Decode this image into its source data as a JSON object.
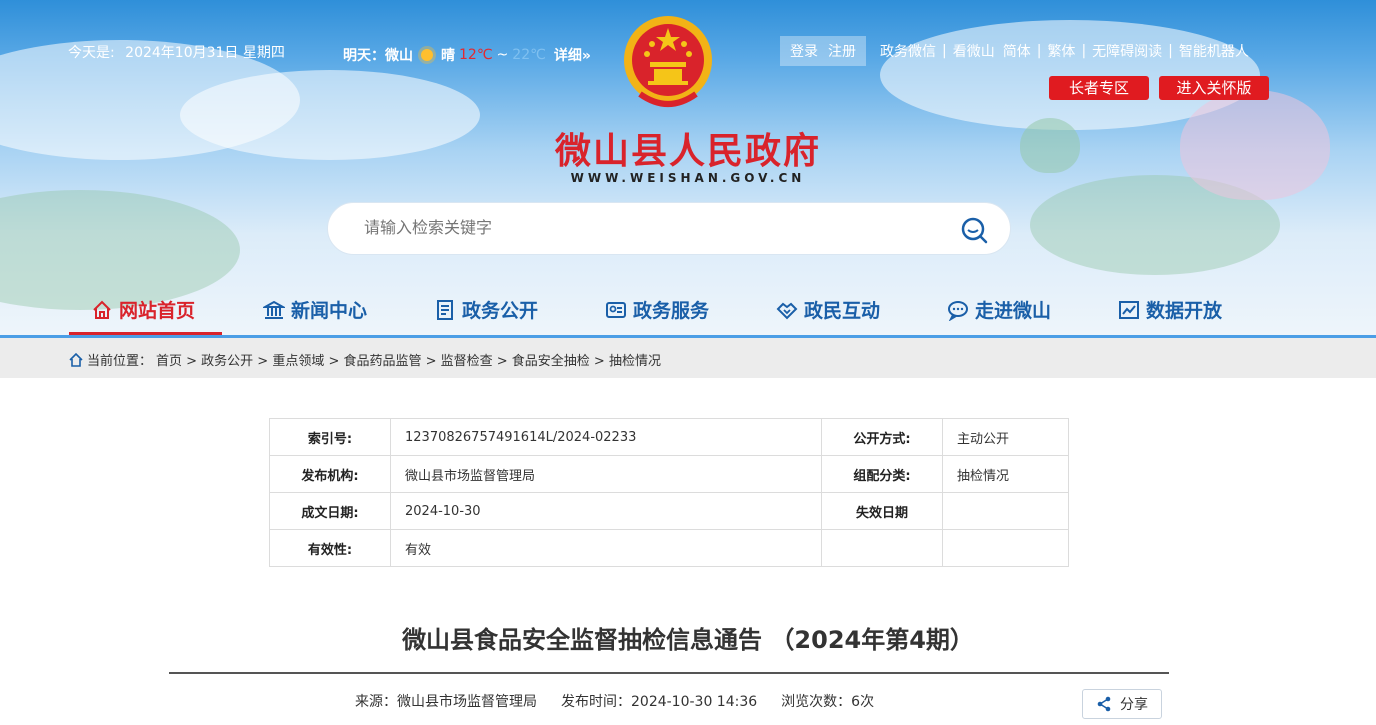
{
  "header": {
    "today_label": "今天是:",
    "today_date": "2024年10月31日 星期四",
    "weather": {
      "label": "明天：微山",
      "condition": "晴",
      "high": "12℃",
      "range_sep": "~",
      "low": "22℃",
      "detail": "详细»"
    },
    "login": "登录",
    "register": "注册",
    "links": [
      "政务微信",
      "看微山",
      "简体",
      "繁体",
      "无障碍阅读",
      "智能机器人"
    ],
    "elder_zone": "长者专区",
    "care_mode": "进入关怀版",
    "site_title": "微山县人民政府",
    "site_domain": "WWW.WEISHAN.GOV.CN"
  },
  "search": {
    "placeholder": "请输入检索关键字"
  },
  "nav": {
    "items": [
      "网站首页",
      "新闻中心",
      "政务公开",
      "政务服务",
      "政民互动",
      "走进微山",
      "数据开放"
    ],
    "active_index": 0
  },
  "breadcrumb": {
    "prefix": "当前位置：",
    "path": "首页 > 政务公开 > 重点领域 > 食品药品监管 > 监督检查 > 食品安全抽检 > 抽检情况"
  },
  "meta_table": {
    "rows": [
      {
        "l1": "索引号:",
        "v1": "12370826757491614L/2024-02233",
        "l2": "公开方式:",
        "v2": "主动公开"
      },
      {
        "l1": "发布机构:",
        "v1": "微山县市场监督管理局",
        "l2": "组配分类:",
        "v2": "抽检情况"
      },
      {
        "l1": "成文日期:",
        "v1": "2024-10-30",
        "l2": "失效日期",
        "v2": ""
      },
      {
        "l1": "有效性:",
        "v1": "有效",
        "l2": "",
        "v2": ""
      }
    ]
  },
  "article": {
    "title": "微山县食品安全监督抽检信息通告 （2024年第4期）",
    "source": "来源：微山县市场监督管理局",
    "publish_time": "发布时间：2024-10-30 14:36",
    "views": "浏览次数：6次",
    "share": "分享"
  },
  "colors": {
    "brand_red": "#d9232b",
    "nav_blue": "#1a5fa8",
    "accent_blue": "#4b9ee6"
  }
}
